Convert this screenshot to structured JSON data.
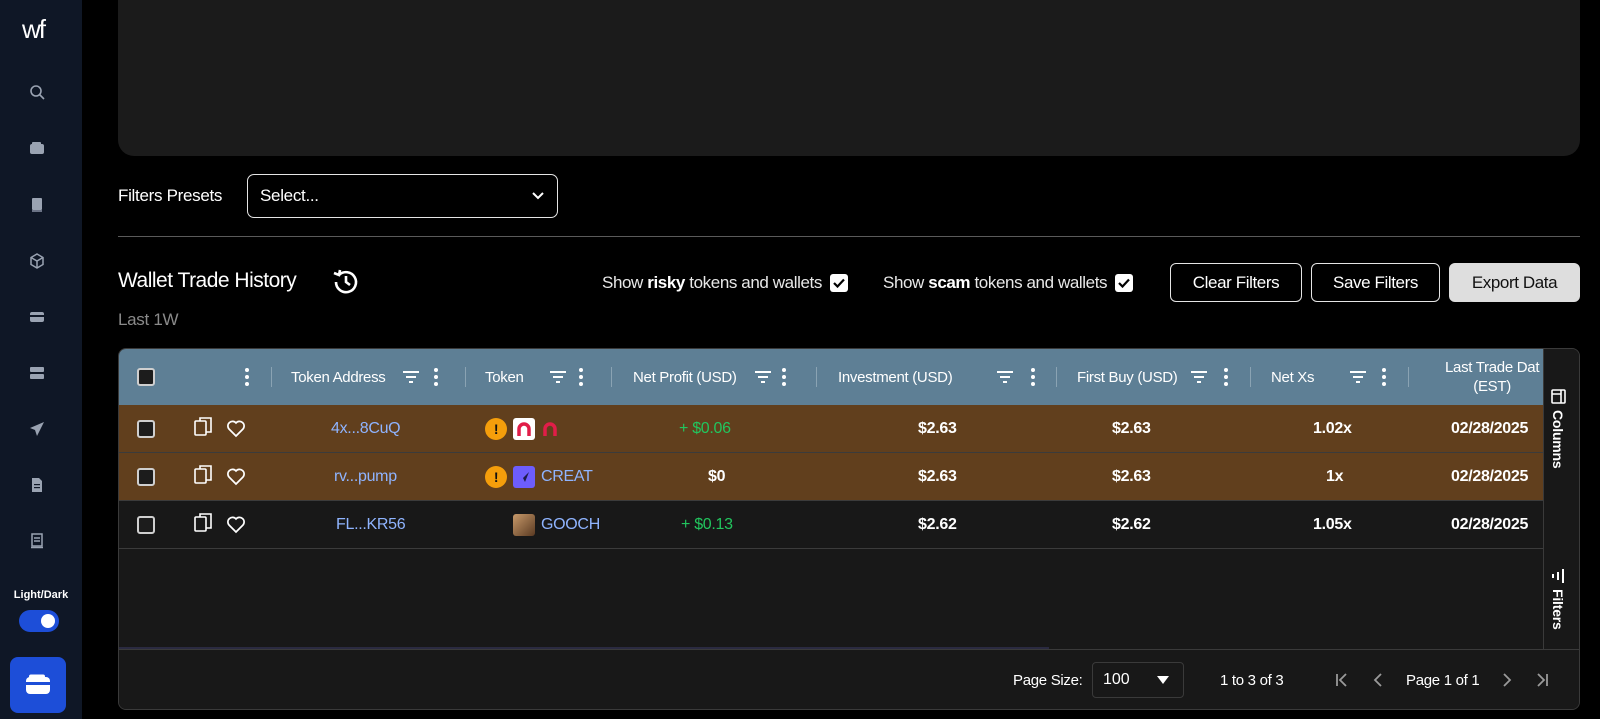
{
  "app": {
    "logo": "wf"
  },
  "sidebar": {
    "icons": [
      "search-icon",
      "wallet-icon",
      "book-icon",
      "cube-icon",
      "card-icon",
      "server-icon",
      "send-icon",
      "document-icon",
      "receipt-icon"
    ],
    "theme_label": "Light/Dark",
    "theme_toggle_on": true,
    "wallet_button_icon": "wallet-icon"
  },
  "filters": {
    "presets_label": "Filters Presets",
    "presets_placeholder": "Select..."
  },
  "section": {
    "title": "Wallet Trade History",
    "subtitle": "Last 1W"
  },
  "options": {
    "risky_prefix": "Show",
    "risky_bold": "risky",
    "risky_suffix": "tokens and wallets",
    "risky_checked": true,
    "scam_prefix": "Show",
    "scam_bold": "scam",
    "scam_suffix": "tokens and wallets",
    "scam_checked": true
  },
  "buttons": {
    "clear": "Clear Filters",
    "save": "Save Filters",
    "export": "Export Data"
  },
  "table": {
    "headers": {
      "token_address": "Token Address",
      "token": "Token",
      "net_profit": "Net Profit (USD)",
      "investment": "Investment (USD)",
      "first_buy": "First Buy (USD)",
      "net_xs": "Net Xs",
      "last_trade_1": "Last Trade Dat",
      "last_trade_2": "(EST)"
    },
    "rows": [
      {
        "address": "4x...8CuQ",
        "warn": "!",
        "token_name": "",
        "token_color": "#e11d48",
        "net_profit": "+ $0.06",
        "investment": "$2.63",
        "first_buy": "$2.63",
        "net_xs": "1.02x",
        "last_trade": "02/28/2025",
        "highlight": "orange"
      },
      {
        "address": "rv...pump",
        "warn": "!",
        "token_name": "CREAT",
        "token_color": "#6d5dfc",
        "net_profit": "$0",
        "investment": "$2.63",
        "first_buy": "$2.63",
        "net_xs": "1x",
        "last_trade": "02/28/2025",
        "highlight": "orange"
      },
      {
        "address": "FL...KR56",
        "warn": "",
        "token_name": "GOOCH",
        "token_color": "#8b5e3c",
        "net_profit": "+ $0.13",
        "investment": "$2.62",
        "first_buy": "$2.62",
        "net_xs": "1.05x",
        "last_trade": "02/28/2025",
        "highlight": "none"
      }
    ],
    "side_tabs": {
      "columns": "Columns",
      "filters": "Filters"
    },
    "footer": {
      "page_size_label": "Page Size:",
      "page_size_value": "100",
      "range": "1 to 3 of 3",
      "page_label": "Page 1 of 1"
    }
  },
  "colors": {
    "header_bg": "#5e7f95",
    "row_highlight": "#613f1d",
    "accent": "#1d4ed8",
    "link": "#8fb4ff",
    "profit": "#22c55e",
    "warning": "#f59e0b"
  }
}
